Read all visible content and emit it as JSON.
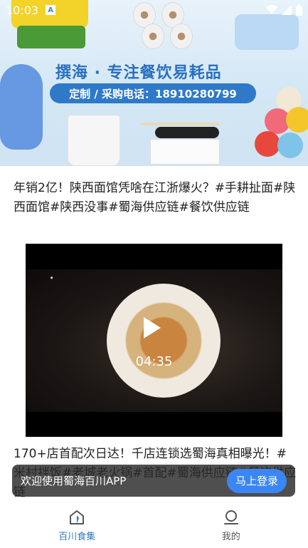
{
  "status_bar": {
    "time": "10:03",
    "app_badge": "A"
  },
  "banner": {
    "headline": "撰海 · 专注餐饮易耗品",
    "phone_line": "定制 / 采购电话：18910280799"
  },
  "articles": [
    {
      "title": "年销2亿！陕西面馆凭啥在江浙爆火？#手耕扯面#陕西面馆#陕西没事#蜀海供应链#餐饮供应链",
      "video": {
        "duration": "04:35"
      }
    },
    {
      "title": "170+店首配次日达！千店连锁选蜀海真相曝光！#米村拌饭#老城老火锅#首配#蜀海供应链#餐饮供应链"
    }
  ],
  "login_prompt": {
    "message": "欢迎使用蜀海百川APP",
    "button": "马上登录"
  },
  "bottom_nav": {
    "items": [
      {
        "label": "百川食集",
        "active": true
      },
      {
        "label": "我的",
        "active": false
      }
    ]
  },
  "colors": {
    "accent": "#2f79c9",
    "login_button": "#3b86f5"
  }
}
